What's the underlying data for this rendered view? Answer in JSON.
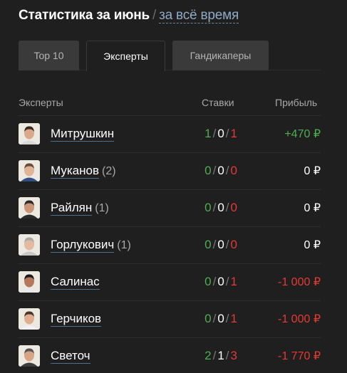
{
  "header": {
    "title": "Статистика за июнь",
    "separator": "/",
    "alt_link": "за всё время"
  },
  "tabs": [
    {
      "label": "Top 10",
      "active": false
    },
    {
      "label": "Эксперты",
      "active": true
    },
    {
      "label": "Гандикаперы",
      "active": false
    }
  ],
  "table": {
    "columns": [
      "Эксперты",
      "Ставки",
      "Прибыль"
    ],
    "rows": [
      {
        "name": "Митрушкин",
        "count": "",
        "wins": "1",
        "draws": "0",
        "losses": "1",
        "profit": "+470 ₽",
        "profit_type": "pos"
      },
      {
        "name": "Муканов",
        "count": "(2)",
        "wins": "0",
        "draws": "0",
        "losses": "0",
        "profit": "0 ₽",
        "profit_type": "zero"
      },
      {
        "name": "Райлян",
        "count": "(1)",
        "wins": "0",
        "draws": "0",
        "losses": "0",
        "profit": "0 ₽",
        "profit_type": "zero"
      },
      {
        "name": "Горлукович",
        "count": "(1)",
        "wins": "0",
        "draws": "0",
        "losses": "0",
        "profit": "0 ₽",
        "profit_type": "zero"
      },
      {
        "name": "Салинас",
        "count": "",
        "wins": "0",
        "draws": "0",
        "losses": "1",
        "profit": "-1 000 ₽",
        "profit_type": "neg"
      },
      {
        "name": "Герчиков",
        "count": "",
        "wins": "0",
        "draws": "0",
        "losses": "1",
        "profit": "-1 000 ₽",
        "profit_type": "neg"
      },
      {
        "name": "Светоч",
        "count": "",
        "wins": "2",
        "draws": "1",
        "losses": "3",
        "profit": "-1 770 ₽",
        "profit_type": "neg"
      }
    ]
  },
  "icons": {
    "avatar": "user-photo-avatar"
  },
  "colors": {
    "background": "#1f1f1f",
    "win": "#4caf50",
    "loss": "#e53935",
    "link_underline": "#4f6f91",
    "alt_link": "#8fa9c7"
  }
}
